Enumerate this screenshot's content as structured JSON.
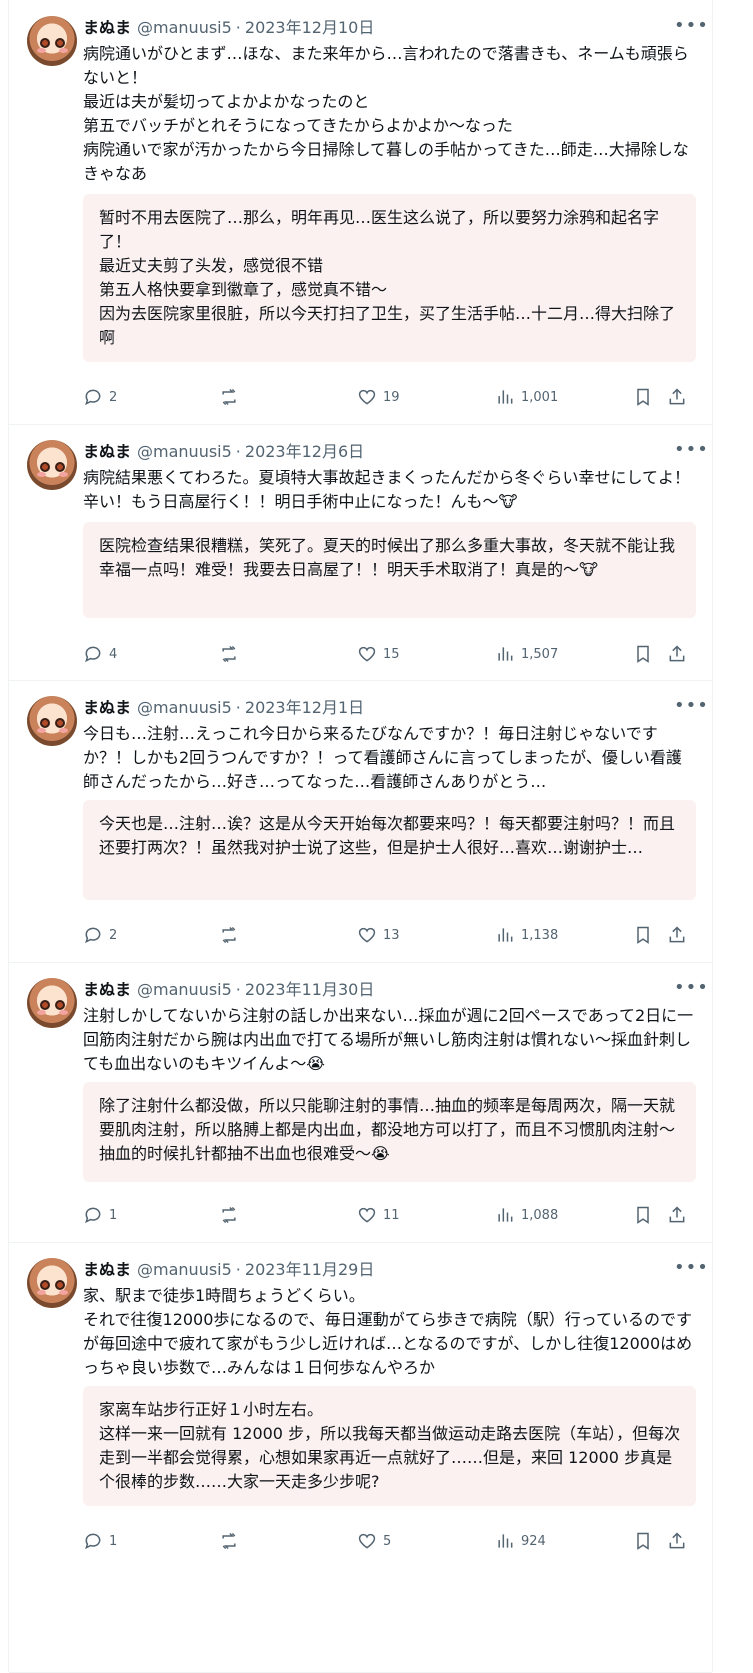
{
  "tweets": [
    {
      "name": "まぬま",
      "handle": "@manuusi5",
      "date": "2023年12月10日",
      "text": "病院通いがひとまず…ほな、また来年から…言われたので落書きも、ネームも頑張らないと！\n最近は夫が髪切ってよかよかなったのと\n第五でバッチがとれそうになってきたからよかよか〜なった\n病院通いで家が汚かったから今日掃除して暮しの手帖かってきた…師走…大掃除しなきゃなあ",
      "translation": "暂时不用去医院了…那么，明年再见…医生这么说了，所以要努力涂鸦和起名字了！\n最近丈夫剪了头发，感觉很不错\n第五人格快要拿到徽章了，感觉真不错～\n因为去医院家里很脏，所以今天打扫了卫生，买了生活手帖…十二月…得大扫除了啊",
      "replies": "2",
      "retweets": "",
      "likes": "19",
      "views": "1,001"
    },
    {
      "name": "まぬま",
      "handle": "@manuusi5",
      "date": "2023年12月6日",
      "text": "病院結果悪くてわろた。夏頃特大事故起きまくったんだから冬ぐらい幸せにしてよ！辛い！もう日高屋行く！！明日手術中止になった！んも〜🐮",
      "translation": "医院检查结果很糟糕，笑死了。夏天的时候出了那么多重大事故，冬天就不能让我幸福一点吗！难受！我要去日高屋了！！明天手术取消了！真是的〜🐮",
      "replies": "4",
      "retweets": "",
      "likes": "15",
      "views": "1,507"
    },
    {
      "name": "まぬま",
      "handle": "@manuusi5",
      "date": "2023年12月1日",
      "text": "今日も…注射…えっこれ今日から来るたびなんですか？！毎日注射じゃないですか？！しかも2回うつんですか？！って看護師さんに言ってしまったが、優しい看護師さんだったから…好き…ってなった…看護師さんありがとう…",
      "translation": "今天也是…注射…诶？这是从今天开始每次都要来吗？！每天都要注射吗？！而且还要打两次？！虽然我对护士说了这些，但是护士人很好…喜欢…谢谢护士…",
      "replies": "2",
      "retweets": "",
      "likes": "13",
      "views": "1,138"
    },
    {
      "name": "まぬま",
      "handle": "@manuusi5",
      "date": "2023年11月30日",
      "text": "注射しかしてないから注射の話しか出来ない…採血が週に2回ペースであって2日に一回筋肉注射だから腕は内出血で打てる場所が無いし筋肉注射は慣れない〜採血針刺しても血出ないのもキツイんよ〜😭",
      "translation": "除了注射什么都没做，所以只能聊注射的事情…抽血的频率是每周两次，隔一天就要肌肉注射，所以胳膊上都是内出血，都没地方可以打了，而且不习惯肌肉注射〜抽血的时候扎针都抽不出血也很难受〜😭",
      "replies": "1",
      "retweets": "",
      "likes": "11",
      "views": "1,088"
    },
    {
      "name": "まぬま",
      "handle": "@manuusi5",
      "date": "2023年11月29日",
      "text": "家、駅まで徒歩1時間ちょうどくらい。\nそれで往復12000歩になるので、毎日運動がてら歩きで病院（駅）行っているのですが毎回途中で疲れて家がもう少し近ければ…となるのですが、しかし往復12000はめっちゃ良い歩数で…みんなは１日何歩なんやろか",
      "translation": "家离车站步行正好１小时左右。\n这样一来一回就有 12000 步，所以我每天都当做运动走路去医院（车站），但每次走到一半都会觉得累，心想如果家再近一点就好了……但是，来回 12000 步真是个很棒的步数……大家一天走多少步呢?",
      "replies": "1",
      "retweets": "",
      "likes": "5",
      "views": "924"
    }
  ]
}
